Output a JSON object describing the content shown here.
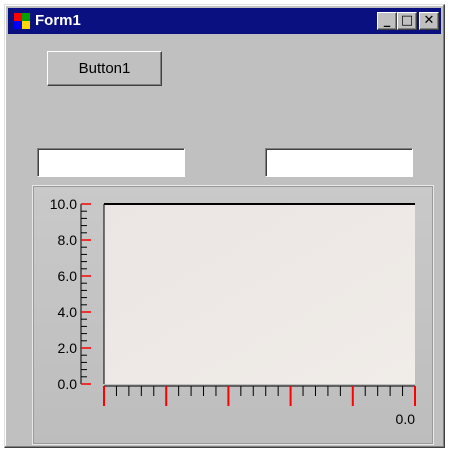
{
  "window": {
    "title": "Form1"
  },
  "titlebar_buttons": {
    "minimize": "_",
    "maximize": "□",
    "close": "✕"
  },
  "button1": {
    "label": "Button1"
  },
  "text_inputs": [
    {
      "value": ""
    },
    {
      "value": ""
    }
  ],
  "plot": {
    "y_tick_labels": [
      "10.0",
      "8.0",
      "6.0",
      "4.0",
      "2.0",
      "0.0"
    ],
    "x_end_label": "0.0",
    "colors": {
      "plot_area_top": "#ebe5e3",
      "plot_area_bottom": "#f0ece8",
      "major_tick": "#ff0000",
      "minor_tick": "#000000"
    }
  }
}
